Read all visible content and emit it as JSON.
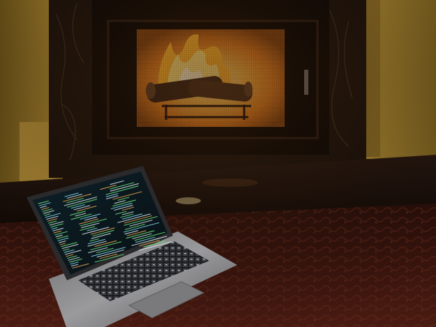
{
  "scene": {
    "subject": "laptop-in-front-of-fireplace",
    "colors": {
      "wall_left": "#9a7a2c",
      "wall_right": "#9e7f2e",
      "wall_shadow": "#5a4315",
      "marble": "#1c120b",
      "marble_vein": "#4a3a2a",
      "firebox_frame": "#0b0604",
      "firebox_brick": "#b86a1c",
      "fire_core": "#fff3b0",
      "fire_outer": "#ff9a1a",
      "log": "#2a1a10",
      "hearth": "#1a0f09",
      "carpet": "#3a1510",
      "carpet_pattern": "#5a2618",
      "laptop_body": "#8a8a8a",
      "laptop_screen_bg": "#0d1a1f",
      "keyboard": "#2b2d30",
      "key_glow": "#b9c3cc",
      "code_green": "#6ee07a",
      "code_cyan": "#7fd4e8",
      "code_white": "#d9e6ea",
      "code_orange": "#e6a34d"
    }
  }
}
